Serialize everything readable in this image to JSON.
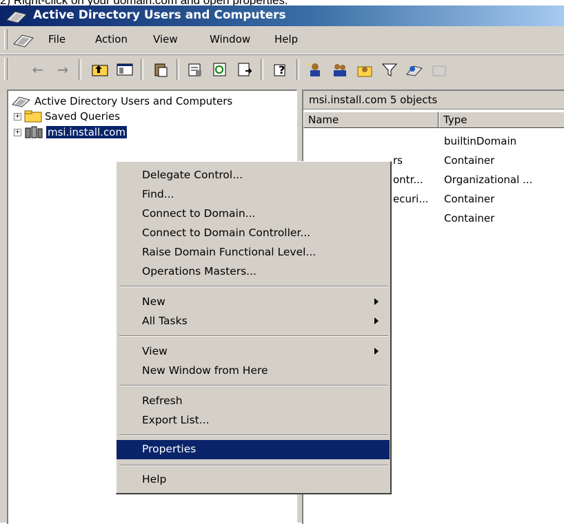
{
  "caption": "2)   Right-click on your domain.com and open properties.",
  "window": {
    "title": "Active Directory Users and Computers"
  },
  "menu": [
    "File",
    "Action",
    "View",
    "Window",
    "Help"
  ],
  "toolbar": {
    "buttons": [
      "back-arrow-icon",
      "forward-arrow-icon",
      "up-folder-icon",
      "show-tree-icon",
      "paste-icon",
      "properties-icon",
      "refresh-icon",
      "export-list-icon",
      "help-icon",
      "new-user-icon",
      "new-group-icon",
      "new-ou-icon",
      "filter-icon",
      "find-icon",
      "delegate-icon"
    ]
  },
  "tree": {
    "root": "Active Directory Users and Computers",
    "items": [
      "Saved Queries",
      "msi.install.com"
    ]
  },
  "right_pane": {
    "header": "msi.install.com    5 objects",
    "columns": [
      "Name",
      "Type"
    ],
    "rows": [
      {
        "name": "",
        "type": "builtinDomain"
      },
      {
        "name": "rs",
        "type": "Container"
      },
      {
        "name": "ontr...",
        "type": "Organizational ..."
      },
      {
        "name": "ecuri...",
        "type": "Container"
      },
      {
        "name": "",
        "type": "Container"
      }
    ]
  },
  "context_menu": {
    "groups": [
      [
        "Delegate Control...",
        "Find...",
        "Connect to Domain...",
        "Connect to Domain Controller...",
        "Raise Domain Functional Level...",
        "Operations Masters..."
      ],
      [
        "New",
        "All Tasks"
      ],
      [
        "View",
        "New Window from Here"
      ],
      [
        "Refresh",
        "Export List..."
      ],
      [
        "Properties"
      ],
      [
        "Help"
      ]
    ],
    "submenu_items": [
      "New",
      "All Tasks",
      "View"
    ],
    "selected": "Properties"
  }
}
